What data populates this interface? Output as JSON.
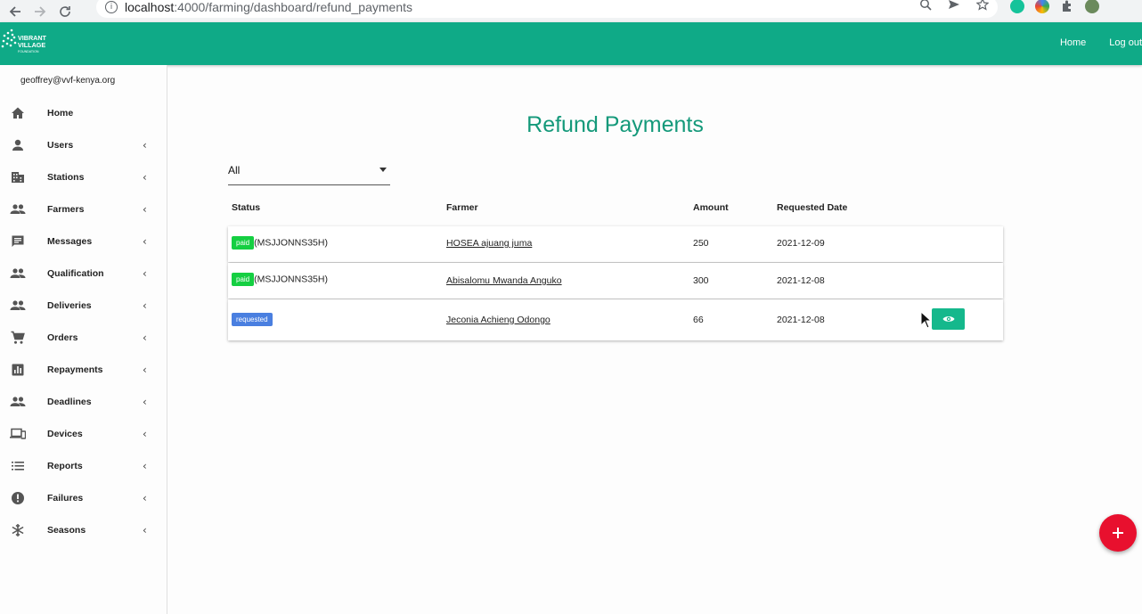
{
  "browser": {
    "url_host": "localhost",
    "url_path": ":4000/farming/dashboard/refund_payments"
  },
  "header": {
    "nav_home": "Home",
    "nav_logout": "Log out",
    "brand_color": "#0faa87"
  },
  "sidebar": {
    "user_email": "geoffrey@vvf-kenya.org",
    "items": [
      {
        "label": "Home",
        "icon": "home-icon",
        "has_submenu": false
      },
      {
        "label": "Users",
        "icon": "person-icon",
        "has_submenu": true
      },
      {
        "label": "Stations",
        "icon": "building-icon",
        "has_submenu": true
      },
      {
        "label": "Farmers",
        "icon": "people-icon",
        "has_submenu": true
      },
      {
        "label": "Messages",
        "icon": "message-icon",
        "has_submenu": true
      },
      {
        "label": "Qualification",
        "icon": "people-icon",
        "has_submenu": true
      },
      {
        "label": "Deliveries",
        "icon": "people-icon",
        "has_submenu": true
      },
      {
        "label": "Orders",
        "icon": "cart-icon",
        "has_submenu": true
      },
      {
        "label": "Repayments",
        "icon": "bar-chart-icon",
        "has_submenu": true
      },
      {
        "label": "Deadlines",
        "icon": "people-icon",
        "has_submenu": true
      },
      {
        "label": "Devices",
        "icon": "devices-icon",
        "has_submenu": true
      },
      {
        "label": "Reports",
        "icon": "list-icon",
        "has_submenu": true
      },
      {
        "label": "Failures",
        "icon": "alert-icon",
        "has_submenu": true
      },
      {
        "label": "Seasons",
        "icon": "snowflake-icon",
        "has_submenu": true
      }
    ]
  },
  "main": {
    "title": "Refund Payments",
    "filter": {
      "selected": "All"
    },
    "columns": [
      "Status",
      "Farmer",
      "Amount",
      "Requested Date"
    ],
    "rows": [
      {
        "status": "paid",
        "ref": "(MSJJONNS35H)",
        "farmer": "HOSEA ajuang juma",
        "amount": "250",
        "date": "2021-12-09",
        "has_view": false
      },
      {
        "status": "paid",
        "ref": "(MSJJONNS35H)",
        "farmer": "Abisalomu Mwanda Anguko",
        "amount": "300",
        "date": "2021-12-08",
        "has_view": false
      },
      {
        "status": "requested",
        "ref": "",
        "farmer": "Jeconia Achieng Odongo",
        "amount": "66",
        "date": "2021-12-08",
        "has_view": true
      }
    ]
  },
  "fab": {
    "icon": "plus-icon",
    "color": "#e8102e"
  }
}
